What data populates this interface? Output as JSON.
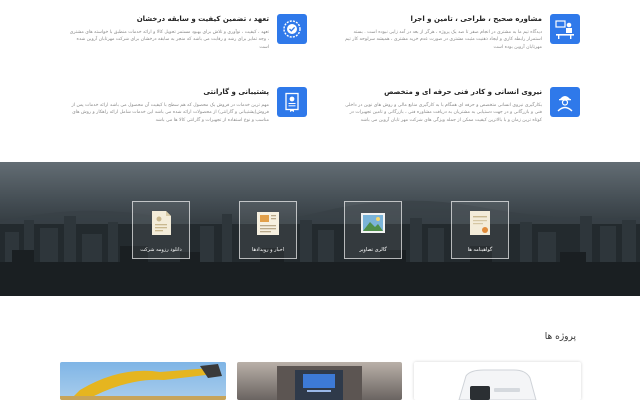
{
  "features": [
    {
      "title": "مشاوره صحیح ، طراحی ، تامین و اجرا",
      "description": "دیدگاه تیم ما به مشتری در انجام صفر تا صد یک پروژه ، هرگز از بعد در آمد زایی نبوده است . بسته استمرار رابطه کاری و ایجاد ذهنیت مثبت مشتری در صورت عدم خرید مشتری ، همیشه سرلوحه کار تیم مهرتابان آروین بوده است",
      "icon": "consulting-icon"
    },
    {
      "title": "تعهد ، تضمین کیفیت و سابقه درخشان",
      "description": "تعهد ، کیفیت ، نوآوری و تلاش برای بهبود مستمر تحویل کالا و ارائه خدمات منطبق با خواسته های مشتری ، وجه تمایز برای رشد و رقابت می باشد که منجر به سابقه درخشان برای شرکت مهرتابان آروین شده است",
      "icon": "quality-badge-icon"
    },
    {
      "title": "نیروی انسانی و کادر فنی حرفه ای و متخصص",
      "description": "بکارگیری نیروی انسانی متخصص و حرفه ای همگام با به کارگیری منابع مالی و روش های نوین در داخلی فنی و بازرگانی و در جهت دستیابی به مشتریان به دریافت مشاوره فنی ، بازرگانی و تامین تجهیزات در کوتاه ترین زمان و با بالاترین کیفیت ممکن از جمله ویژگی های شرکت مهر تابان آروین می باشد",
      "icon": "engineer-icon"
    },
    {
      "title": "پشتیبانی و گارانتی",
      "description": "مهم ترین خدمات در فروش یک محصول که هم سطح با کیفیت آن محصول می باشد ارائه خدمات پس از فروش(پشتیبانی و گارانتی) از محصولات ارائه شده می باشد این خدمات شامل ارائه راهکار و روش های مناسب و نوع استفاده از تجهیزات و گارانتی کالا ها می باشد",
      "icon": "warranty-certificate-icon"
    }
  ],
  "tiles": [
    {
      "label": "گواهینامه ها",
      "icon": "certificate-icon"
    },
    {
      "label": "گالری تصاویر",
      "icon": "gallery-icon"
    },
    {
      "label": "اخبار و رویدادها",
      "icon": "news-icon"
    },
    {
      "label": "دانلود رزومه شرکت",
      "icon": "resume-download-icon"
    }
  ],
  "projects": {
    "title": "پروژه ها",
    "cards": [
      "label-printer-image",
      "elevator-cabin-image",
      "excavator-image"
    ]
  },
  "colors": {
    "accent": "#2f79ea",
    "title": "#222222",
    "muted": "#8a8a8a"
  }
}
